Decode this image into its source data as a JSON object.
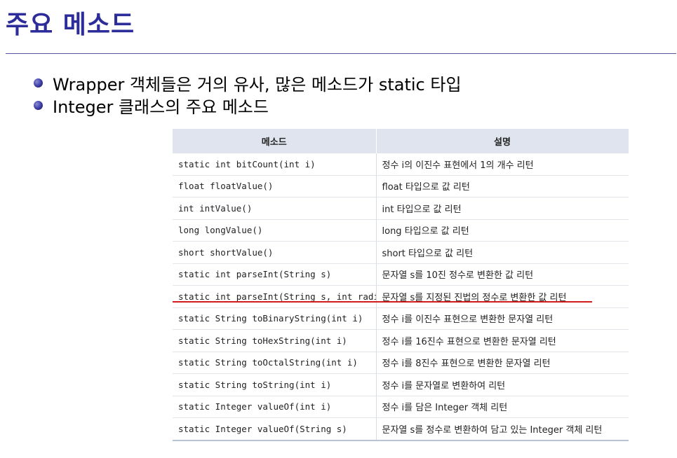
{
  "title": "주요 메소드",
  "bullets": [
    "Wrapper 객체들은 거의 유사, 많은 메소드가 static 타입",
    "Integer 클래스의 주요 메소드"
  ],
  "table": {
    "headers": [
      "메소드",
      "설명"
    ],
    "rows": [
      {
        "method": "static int bitCount(int i)",
        "desc": "정수 i의 이진수 표현에서 1의 개수 리턴"
      },
      {
        "method": "float floatValue()",
        "desc": "float 타입으로 값 리턴"
      },
      {
        "method": "int intValue()",
        "desc": "int 타입으로 값 리턴"
      },
      {
        "method": "long longValue()",
        "desc": "long 타입으로 값 리턴"
      },
      {
        "method": "short shortValue()",
        "desc": "short 타입으로 값 리턴"
      },
      {
        "method": "static int parseInt(String s)",
        "desc": "문자열 s를 10진 정수로 변환한 값 리턴"
      },
      {
        "method": "static int parseInt(String s, int radix)",
        "desc": "문자열 s를 지정된 진법의 정수로 변환한 값 리턴"
      },
      {
        "method": "static String toBinaryString(int i)",
        "desc": "정수 i를 이진수 표현으로 변환한 문자열 리턴"
      },
      {
        "method": "static String toHexString(int i)",
        "desc": "정수 i를 16진수 표현으로 변환한 문자열 리턴"
      },
      {
        "method": "static String toOctalString(int i)",
        "desc": "정수 i를 8진수 표현으로 변환한 문자열 리턴"
      },
      {
        "method": "static String toString(int i)",
        "desc": "정수 i를 문자열로 변환하여 리턴"
      },
      {
        "method": "static Integer valueOf(int i)",
        "desc": "정수 i를 담은 Integer 객체 리턴"
      },
      {
        "method": "static Integer valueOf(String s)",
        "desc": "문자열 s를 정수로 변환하여 담고 있는 Integer 객체 리턴"
      }
    ]
  },
  "colors": {
    "title": "#2c2c9a",
    "header_bg": "#dfe4ee",
    "underline": "#d21c1c"
  }
}
